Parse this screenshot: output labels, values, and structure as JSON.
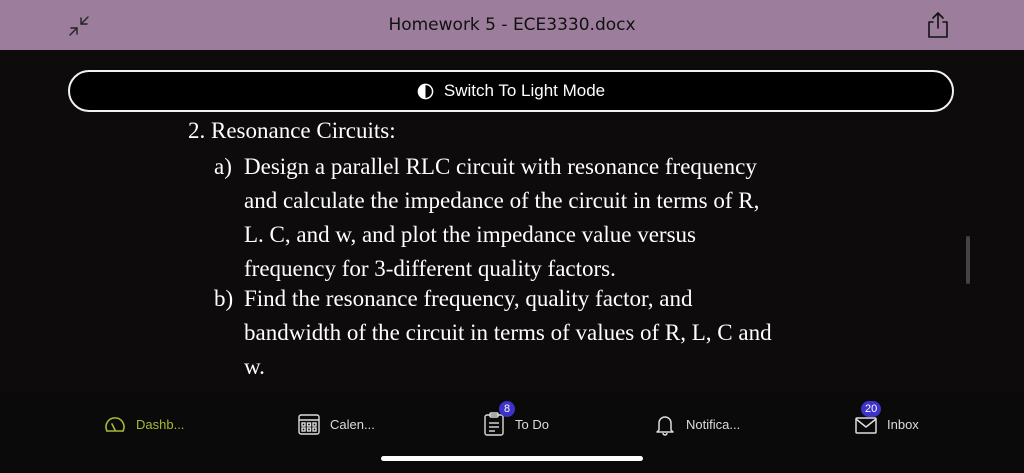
{
  "titlebar": {
    "title": "Homework 5 - ECE3330.docx",
    "collapse_icon": "arrows-collapse-icon",
    "share_icon": "share-icon"
  },
  "mode_toggle": {
    "label": "Switch To Light Mode",
    "icon": "half-circle-contrast-icon"
  },
  "document": {
    "heading": "2. Resonance Circuits:",
    "items": [
      {
        "marker": "a)",
        "lines": [
          "Design a parallel RLC circuit with resonance frequency",
          "and calculate the impedance of the circuit in terms of R,",
          "L. C, and w, and plot the impedance value versus",
          "frequency for 3-different quality factors."
        ]
      },
      {
        "marker": "b)",
        "lines": [
          "Find the resonance frequency, quality factor, and",
          "bandwidth of the circuit in terms of values of R, L, C and",
          "w."
        ]
      }
    ]
  },
  "tabs": [
    {
      "label": "Dashb...",
      "icon": "dashboard-gauge-icon",
      "color": "#a8b832",
      "badge": ""
    },
    {
      "label": "Calen...",
      "icon": "calendar-icon",
      "color": "#dddddd",
      "badge": ""
    },
    {
      "label": "To Do",
      "icon": "todo-clipboard-icon",
      "color": "#dddddd",
      "badge": "8"
    },
    {
      "label": "Notifica...",
      "icon": "bell-icon",
      "color": "#dddddd",
      "badge": ""
    },
    {
      "label": "Inbox",
      "icon": "inbox-envelope-icon",
      "color": "#dddddd",
      "badge": "20"
    }
  ]
}
